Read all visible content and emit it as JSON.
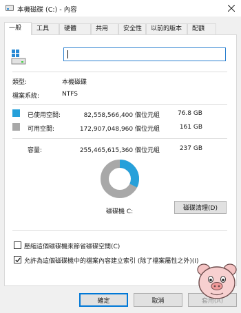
{
  "window": {
    "title": "本機磁碟 (C:) - 內容",
    "app_icon": "drive-icon",
    "close_icon": "close-icon"
  },
  "tabs": [
    {
      "label": "一般",
      "active": true
    },
    {
      "label": "工具",
      "active": false
    },
    {
      "label": "硬體",
      "active": false
    },
    {
      "label": "共用",
      "active": false
    },
    {
      "label": "安全性",
      "active": false
    },
    {
      "label": "以前的版本",
      "active": false
    },
    {
      "label": "配額",
      "active": false
    }
  ],
  "general": {
    "drive_name_value": "",
    "type_label": "類型:",
    "type_value": "本機磁碟",
    "fs_label": "檔案系統:",
    "fs_value": "NTFS",
    "used": {
      "label": "已使用空間:",
      "bytes": "82,558,566,400 個位元組",
      "size": "76.8 GB",
      "color": "#26a0da"
    },
    "free": {
      "label": "可用空間:",
      "bytes": "172,907,048,960 個位元組",
      "size": "161 GB",
      "color": "#a8a8a8"
    },
    "capacity": {
      "label": "容量:",
      "bytes": "255,465,615,360 個位元組",
      "size": "237 GB"
    },
    "used_fraction": 0.323,
    "drive_label": "磁碟機 C:",
    "cleanup_button": "磁碟清理(D)",
    "compress_checkbox": {
      "label": "壓縮這個磁碟機來節省磁碟空間(C)",
      "checked": false
    },
    "index_checkbox": {
      "label": "允許為這個磁碟機中的檔案內容建立索引 (除了檔案屬性之外)(I)",
      "checked": true
    }
  },
  "buttons": {
    "ok": "確定",
    "cancel": "取消",
    "apply": "套用(A)"
  },
  "mascot_icon": "pig-mascot-icon"
}
